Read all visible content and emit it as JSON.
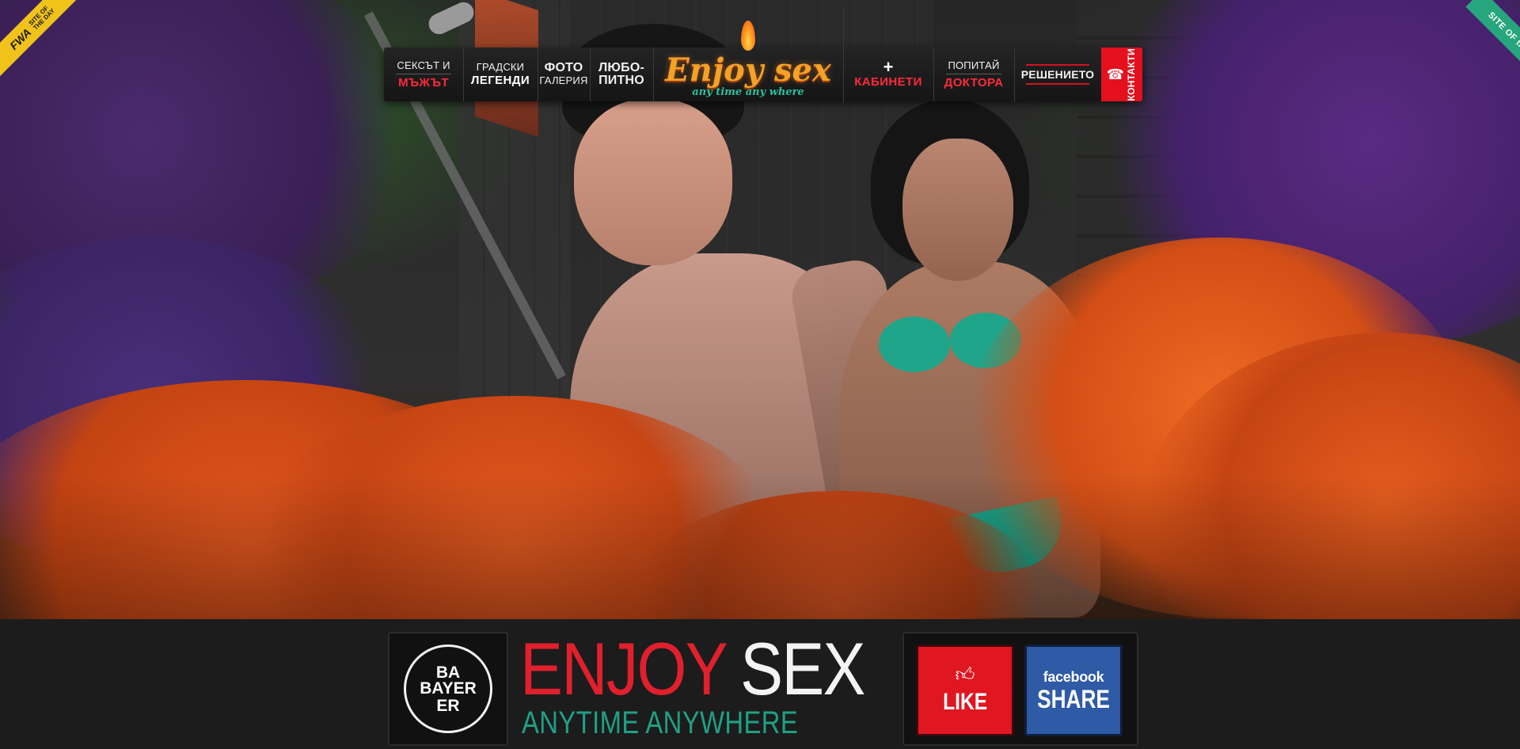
{
  "nav": {
    "items": [
      {
        "line1": "СЕКСЪТ И",
        "line2": "МЪЖЪТ"
      },
      {
        "line1": "ГРАДСКИ",
        "line2": "ЛЕГЕНДИ"
      },
      {
        "line1": "ФОТО",
        "line2": "ГАЛЕРИЯ"
      },
      {
        "line1": "ЛЮБО-",
        "line2": "ПИТНО"
      }
    ],
    "logo": {
      "title": "Enjoy sex",
      "subtitle": "any time any where"
    },
    "right_items": [
      {
        "line1": "+",
        "line2": "КАБИНЕТИ"
      },
      {
        "line1": "ПОПИТАЙ",
        "line2": "ДОКТОРА"
      },
      {
        "line1": "РЕШЕНИЕТО"
      }
    ],
    "contacts": {
      "label": "КОНТАКТИ",
      "icon": "phone-icon"
    }
  },
  "ribbons": {
    "fwa": {
      "logo": "FWA",
      "text": "SITE OF THE DAY"
    },
    "sotd": {
      "text": "SITE OF the DAY"
    }
  },
  "footer": {
    "bayer": {
      "horizontal": "BAYER",
      "top": "BA",
      "bottom": "ER"
    },
    "title_red": "ENJOY",
    "title_white": "SEX",
    "subtitle": "ANYTIME ANYWHERE",
    "like": {
      "label": "LIKE",
      "icon": "thumbs-up-icon"
    },
    "share": {
      "brand": "facebook",
      "label": "SHARE"
    }
  },
  "colors": {
    "accent_red": "#e0202c",
    "accent_teal": "#1fa085",
    "facebook_blue": "#2e5aa6",
    "fwa_yellow": "#f0c21a",
    "sotd_green": "#27a57c"
  }
}
